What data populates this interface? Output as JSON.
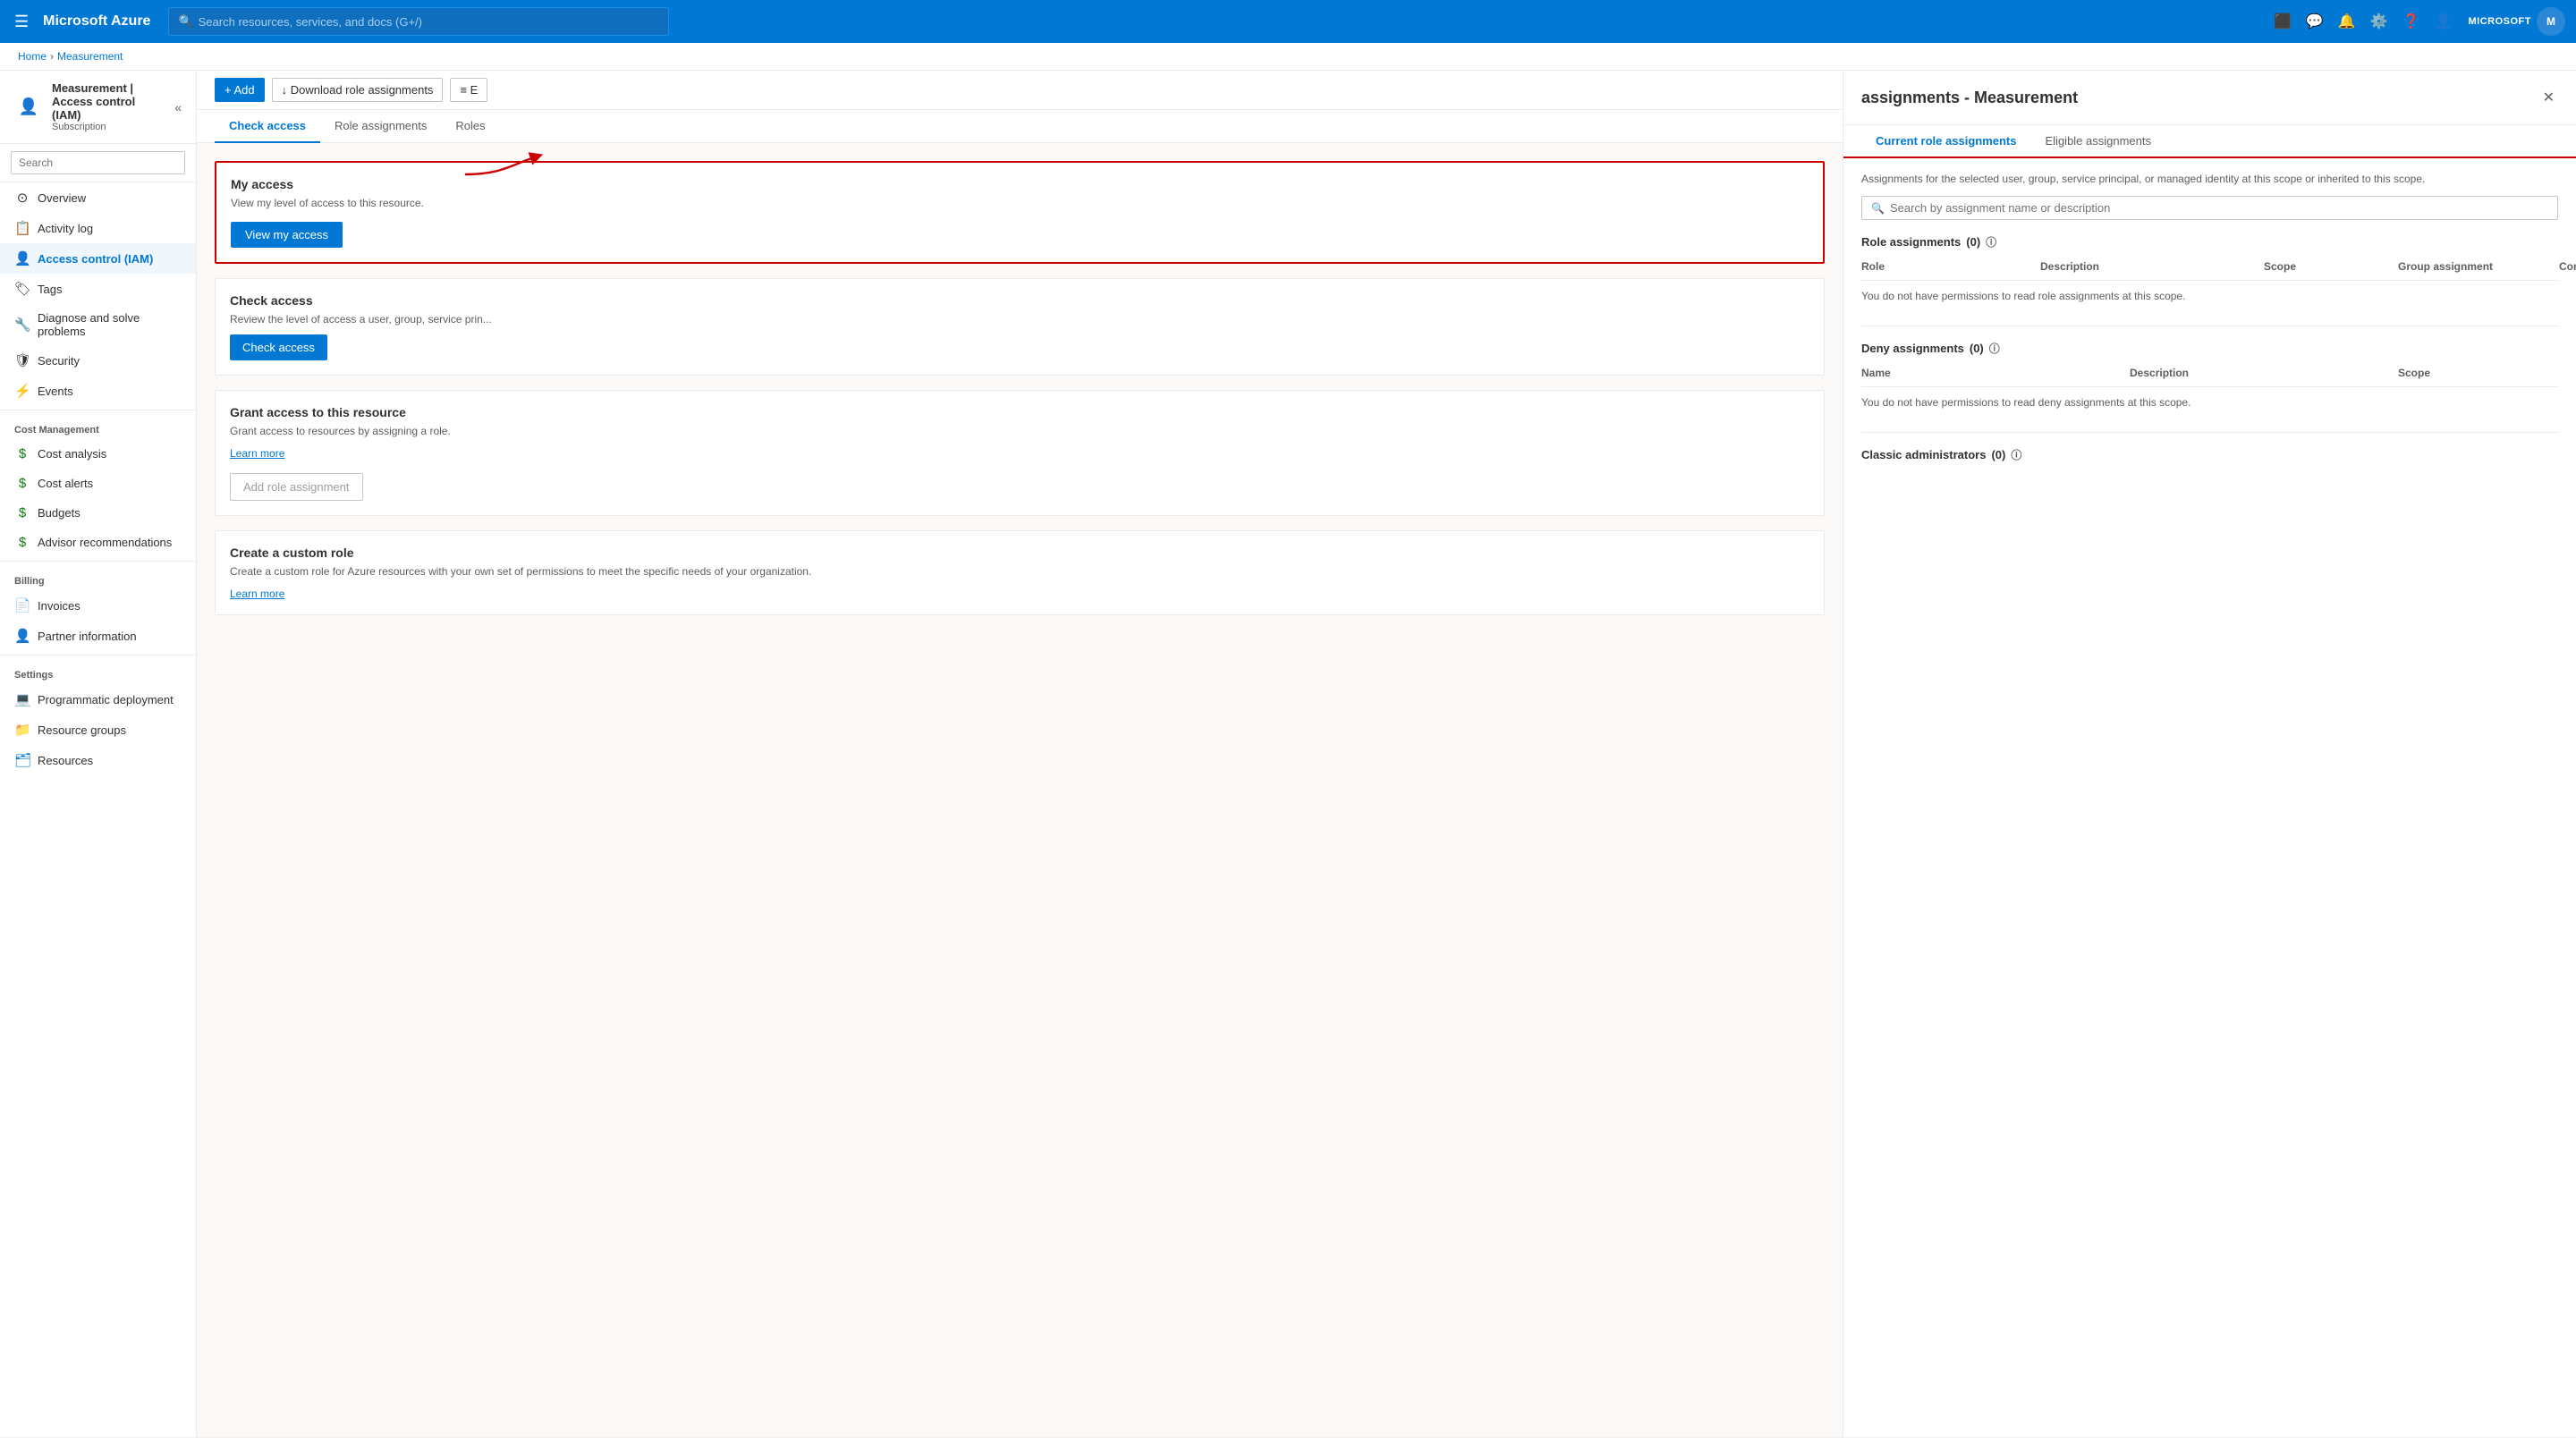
{
  "topnav": {
    "logo": "Microsoft Azure",
    "search_placeholder": "Search resources, services, and docs (G+/)",
    "user_label": "MICROSOFT",
    "user_initials": "M"
  },
  "breadcrumb": {
    "home": "Home",
    "resource": "Measurement"
  },
  "sidebar": {
    "resource_name": "Measurement | Access control (IAM)",
    "resource_type": "Subscription",
    "search_placeholder": "Search",
    "items": [
      {
        "label": "Overview",
        "icon": "⊙",
        "active": false
      },
      {
        "label": "Activity log",
        "icon": "≡",
        "active": false
      },
      {
        "label": "Access control (IAM)",
        "icon": "👤",
        "active": true
      },
      {
        "label": "Tags",
        "icon": "🏷",
        "active": false
      },
      {
        "label": "Diagnose and solve problems",
        "icon": "🔧",
        "active": false
      },
      {
        "label": "Security",
        "icon": "🛡",
        "active": false
      },
      {
        "label": "Events",
        "icon": "⚡",
        "active": false
      }
    ],
    "sections": {
      "cost_management": {
        "label": "Cost Management",
        "items": [
          {
            "label": "Cost analysis",
            "icon": "💲"
          },
          {
            "label": "Cost alerts",
            "icon": "💲"
          },
          {
            "label": "Budgets",
            "icon": "💲"
          },
          {
            "label": "Advisor recommendations",
            "icon": "💲"
          }
        ]
      },
      "billing": {
        "label": "Billing",
        "items": [
          {
            "label": "Invoices",
            "icon": "📄"
          },
          {
            "label": "Partner information",
            "icon": "👤"
          }
        ]
      },
      "settings": {
        "label": "Settings",
        "items": [
          {
            "label": "Programmatic deployment",
            "icon": "💻"
          },
          {
            "label": "Resource groups",
            "icon": "📁"
          },
          {
            "label": "Resources",
            "icon": "🗂"
          }
        ]
      }
    }
  },
  "iam": {
    "title": "Measurement | Access control (IAM)",
    "toolbar": {
      "add_label": "+ Add",
      "download_label": "↓ Download role assignments",
      "edit_label": "≡ E"
    },
    "tabs": [
      {
        "label": "Check access",
        "active": true
      },
      {
        "label": "Role assignments",
        "active": false
      },
      {
        "label": "Roles",
        "active": false
      }
    ],
    "my_access_card": {
      "title": "My access",
      "desc": "View my level of access to this resource.",
      "btn_label": "View my access"
    },
    "check_access_card": {
      "title": "Check access",
      "desc": "Review the level of access a user, group, service prin...",
      "btn_label": "Check access"
    },
    "grant_access_card": {
      "title": "Grant access to this resource",
      "desc": "Grant access to resources by assigning a role.",
      "learn_more": "Learn more",
      "btn_label": "Add role assignment"
    },
    "custom_role_card": {
      "title": "Create a custom role",
      "desc": "Create a custom role for Azure resources with your own set of permissions to meet the specific needs of your organization.",
      "learn_more": "Learn more"
    }
  },
  "panel": {
    "title": "assignments - Measurement",
    "tabs": [
      {
        "label": "Current role assignments",
        "active": true
      },
      {
        "label": "Eligible assignments",
        "active": false
      }
    ],
    "desc": "Assignments for the selected user, group, service principal, or managed identity at this scope or inherited to this scope.",
    "search_placeholder": "Search by assignment name or description",
    "role_assignments": {
      "label": "Role assignments",
      "count": "(0)",
      "columns": [
        "Role",
        "Description",
        "Scope",
        "Group assignment",
        "Condition"
      ],
      "empty_msg": "You do not have permissions to read role assignments at this scope."
    },
    "deny_assignments": {
      "label": "Deny assignments",
      "count": "(0)",
      "columns": [
        "Name",
        "Description",
        "Scope"
      ],
      "empty_msg": "You do not have permissions to read deny assignments at this scope."
    },
    "classic_admins": {
      "label": "Classic administrators",
      "count": "(0)"
    }
  }
}
